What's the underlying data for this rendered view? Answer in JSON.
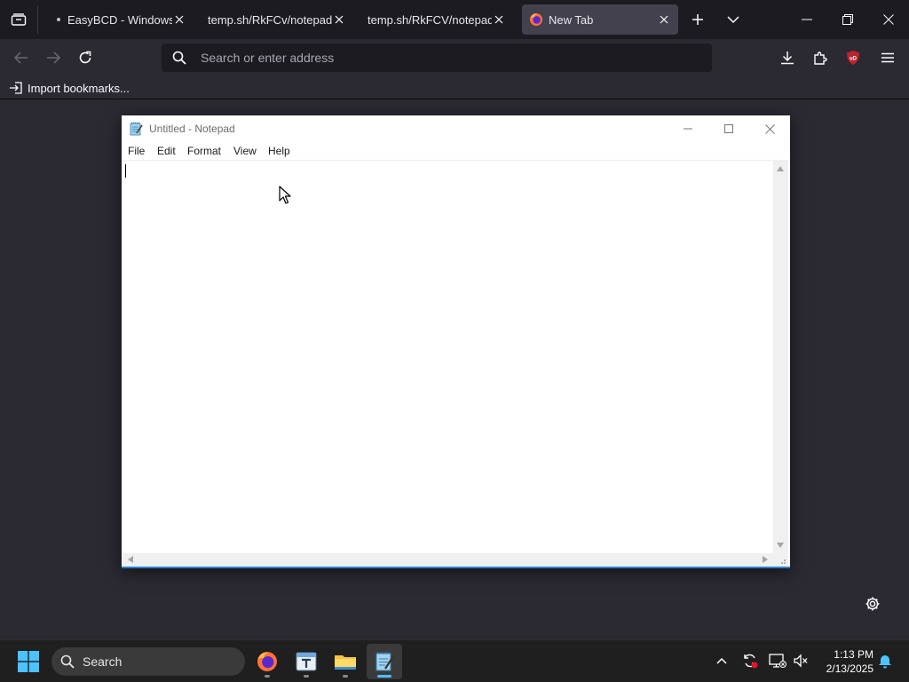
{
  "browser": {
    "tabs": [
      {
        "title": "EasyBCD - Windows Bo",
        "active": false,
        "unread_dot": true
      },
      {
        "title": "temp.sh/RkFCv/notepad.ex",
        "active": false
      },
      {
        "title": "temp.sh/RkFCV/notepad.ex",
        "active": false
      },
      {
        "title": "New Tab",
        "active": true
      }
    ],
    "urlbar": {
      "placeholder": "Search or enter address",
      "value": ""
    },
    "bookmarks_toolbar": {
      "import_label": "Import bookmarks..."
    }
  },
  "notepad": {
    "title": "Untitled - Notepad",
    "menu": [
      "File",
      "Edit",
      "Format",
      "View",
      "Help"
    ],
    "text": ""
  },
  "taskbar": {
    "search_label": "Search",
    "pinned_apps": [
      "firefox-icon",
      "text-editor-icon",
      "file-explorer-icon",
      "notepad-icon"
    ],
    "clock": {
      "time": "1:13 PM",
      "date": "2/13/2025"
    }
  },
  "colors": {
    "accent": "#4cc2ff",
    "browser_bg": "#2b2a33",
    "tabbar_bg": "#1c1b22",
    "ublock_red": "#c0222e"
  }
}
